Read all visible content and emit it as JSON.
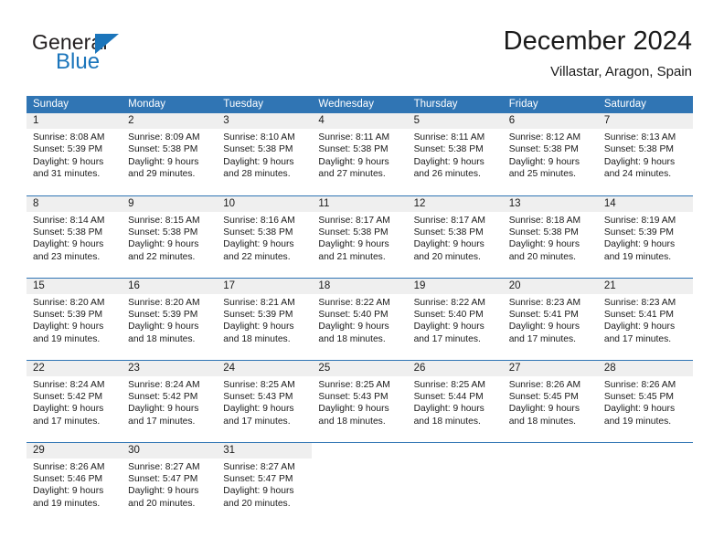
{
  "logo": {
    "word_top": "General",
    "word_bottom": "Blue",
    "triangle_color": "#1b75bb"
  },
  "header": {
    "title": "December 2024",
    "subtitle": "Villastar, Aragon, Spain"
  },
  "theme": {
    "header_blue": "#3075b4",
    "daynum_gray": "#efefef",
    "text": "#1a1a1a"
  },
  "calendar": {
    "day_names": [
      "Sunday",
      "Monday",
      "Tuesday",
      "Wednesday",
      "Thursday",
      "Friday",
      "Saturday"
    ],
    "weeks": [
      [
        {
          "day": "1",
          "sunrise": "Sunrise: 8:08 AM",
          "sunset": "Sunset: 5:39 PM",
          "daylight1": "Daylight: 9 hours",
          "daylight2": "and 31 minutes."
        },
        {
          "day": "2",
          "sunrise": "Sunrise: 8:09 AM",
          "sunset": "Sunset: 5:38 PM",
          "daylight1": "Daylight: 9 hours",
          "daylight2": "and 29 minutes."
        },
        {
          "day": "3",
          "sunrise": "Sunrise: 8:10 AM",
          "sunset": "Sunset: 5:38 PM",
          "daylight1": "Daylight: 9 hours",
          "daylight2": "and 28 minutes."
        },
        {
          "day": "4",
          "sunrise": "Sunrise: 8:11 AM",
          "sunset": "Sunset: 5:38 PM",
          "daylight1": "Daylight: 9 hours",
          "daylight2": "and 27 minutes."
        },
        {
          "day": "5",
          "sunrise": "Sunrise: 8:11 AM",
          "sunset": "Sunset: 5:38 PM",
          "daylight1": "Daylight: 9 hours",
          "daylight2": "and 26 minutes."
        },
        {
          "day": "6",
          "sunrise": "Sunrise: 8:12 AM",
          "sunset": "Sunset: 5:38 PM",
          "daylight1": "Daylight: 9 hours",
          "daylight2": "and 25 minutes."
        },
        {
          "day": "7",
          "sunrise": "Sunrise: 8:13 AM",
          "sunset": "Sunset: 5:38 PM",
          "daylight1": "Daylight: 9 hours",
          "daylight2": "and 24 minutes."
        }
      ],
      [
        {
          "day": "8",
          "sunrise": "Sunrise: 8:14 AM",
          "sunset": "Sunset: 5:38 PM",
          "daylight1": "Daylight: 9 hours",
          "daylight2": "and 23 minutes."
        },
        {
          "day": "9",
          "sunrise": "Sunrise: 8:15 AM",
          "sunset": "Sunset: 5:38 PM",
          "daylight1": "Daylight: 9 hours",
          "daylight2": "and 22 minutes."
        },
        {
          "day": "10",
          "sunrise": "Sunrise: 8:16 AM",
          "sunset": "Sunset: 5:38 PM",
          "daylight1": "Daylight: 9 hours",
          "daylight2": "and 22 minutes."
        },
        {
          "day": "11",
          "sunrise": "Sunrise: 8:17 AM",
          "sunset": "Sunset: 5:38 PM",
          "daylight1": "Daylight: 9 hours",
          "daylight2": "and 21 minutes."
        },
        {
          "day": "12",
          "sunrise": "Sunrise: 8:17 AM",
          "sunset": "Sunset: 5:38 PM",
          "daylight1": "Daylight: 9 hours",
          "daylight2": "and 20 minutes."
        },
        {
          "day": "13",
          "sunrise": "Sunrise: 8:18 AM",
          "sunset": "Sunset: 5:38 PM",
          "daylight1": "Daylight: 9 hours",
          "daylight2": "and 20 minutes."
        },
        {
          "day": "14",
          "sunrise": "Sunrise: 8:19 AM",
          "sunset": "Sunset: 5:39 PM",
          "daylight1": "Daylight: 9 hours",
          "daylight2": "and 19 minutes."
        }
      ],
      [
        {
          "day": "15",
          "sunrise": "Sunrise: 8:20 AM",
          "sunset": "Sunset: 5:39 PM",
          "daylight1": "Daylight: 9 hours",
          "daylight2": "and 19 minutes."
        },
        {
          "day": "16",
          "sunrise": "Sunrise: 8:20 AM",
          "sunset": "Sunset: 5:39 PM",
          "daylight1": "Daylight: 9 hours",
          "daylight2": "and 18 minutes."
        },
        {
          "day": "17",
          "sunrise": "Sunrise: 8:21 AM",
          "sunset": "Sunset: 5:39 PM",
          "daylight1": "Daylight: 9 hours",
          "daylight2": "and 18 minutes."
        },
        {
          "day": "18",
          "sunrise": "Sunrise: 8:22 AM",
          "sunset": "Sunset: 5:40 PM",
          "daylight1": "Daylight: 9 hours",
          "daylight2": "and 18 minutes."
        },
        {
          "day": "19",
          "sunrise": "Sunrise: 8:22 AM",
          "sunset": "Sunset: 5:40 PM",
          "daylight1": "Daylight: 9 hours",
          "daylight2": "and 17 minutes."
        },
        {
          "day": "20",
          "sunrise": "Sunrise: 8:23 AM",
          "sunset": "Sunset: 5:41 PM",
          "daylight1": "Daylight: 9 hours",
          "daylight2": "and 17 minutes."
        },
        {
          "day": "21",
          "sunrise": "Sunrise: 8:23 AM",
          "sunset": "Sunset: 5:41 PM",
          "daylight1": "Daylight: 9 hours",
          "daylight2": "and 17 minutes."
        }
      ],
      [
        {
          "day": "22",
          "sunrise": "Sunrise: 8:24 AM",
          "sunset": "Sunset: 5:42 PM",
          "daylight1": "Daylight: 9 hours",
          "daylight2": "and 17 minutes."
        },
        {
          "day": "23",
          "sunrise": "Sunrise: 8:24 AM",
          "sunset": "Sunset: 5:42 PM",
          "daylight1": "Daylight: 9 hours",
          "daylight2": "and 17 minutes."
        },
        {
          "day": "24",
          "sunrise": "Sunrise: 8:25 AM",
          "sunset": "Sunset: 5:43 PM",
          "daylight1": "Daylight: 9 hours",
          "daylight2": "and 17 minutes."
        },
        {
          "day": "25",
          "sunrise": "Sunrise: 8:25 AM",
          "sunset": "Sunset: 5:43 PM",
          "daylight1": "Daylight: 9 hours",
          "daylight2": "and 18 minutes."
        },
        {
          "day": "26",
          "sunrise": "Sunrise: 8:25 AM",
          "sunset": "Sunset: 5:44 PM",
          "daylight1": "Daylight: 9 hours",
          "daylight2": "and 18 minutes."
        },
        {
          "day": "27",
          "sunrise": "Sunrise: 8:26 AM",
          "sunset": "Sunset: 5:45 PM",
          "daylight1": "Daylight: 9 hours",
          "daylight2": "and 18 minutes."
        },
        {
          "day": "28",
          "sunrise": "Sunrise: 8:26 AM",
          "sunset": "Sunset: 5:45 PM",
          "daylight1": "Daylight: 9 hours",
          "daylight2": "and 19 minutes."
        }
      ],
      [
        {
          "day": "29",
          "sunrise": "Sunrise: 8:26 AM",
          "sunset": "Sunset: 5:46 PM",
          "daylight1": "Daylight: 9 hours",
          "daylight2": "and 19 minutes."
        },
        {
          "day": "30",
          "sunrise": "Sunrise: 8:27 AM",
          "sunset": "Sunset: 5:47 PM",
          "daylight1": "Daylight: 9 hours",
          "daylight2": "and 20 minutes."
        },
        {
          "day": "31",
          "sunrise": "Sunrise: 8:27 AM",
          "sunset": "Sunset: 5:47 PM",
          "daylight1": "Daylight: 9 hours",
          "daylight2": "and 20 minutes."
        },
        {
          "day": "",
          "sunrise": "",
          "sunset": "",
          "daylight1": "",
          "daylight2": ""
        },
        {
          "day": "",
          "sunrise": "",
          "sunset": "",
          "daylight1": "",
          "daylight2": ""
        },
        {
          "day": "",
          "sunrise": "",
          "sunset": "",
          "daylight1": "",
          "daylight2": ""
        },
        {
          "day": "",
          "sunrise": "",
          "sunset": "",
          "daylight1": "",
          "daylight2": ""
        }
      ]
    ]
  }
}
